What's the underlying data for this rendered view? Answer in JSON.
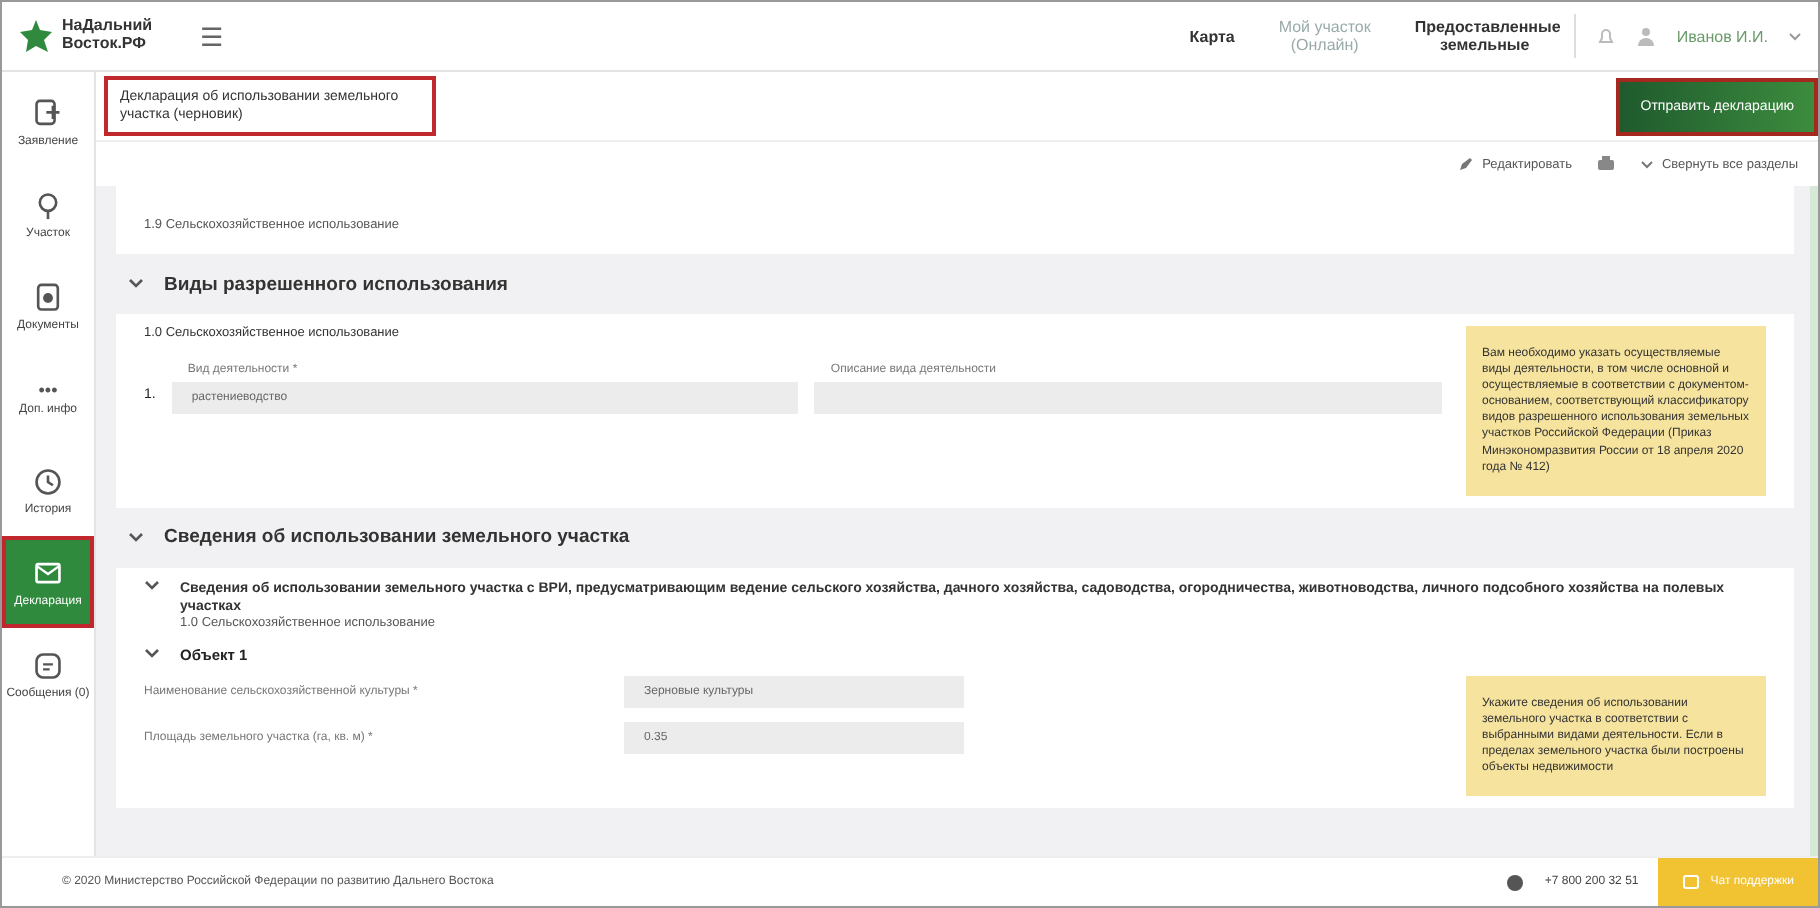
{
  "header": {
    "logo": [
      "НаДальний",
      "Восток.РФ"
    ],
    "menu_glyph": "☰",
    "nav": [
      {
        "label": "Карта",
        "disabled": false
      },
      {
        "label": "Мой участок (Онлайн)",
        "disabled": true
      },
      {
        "label": "Предоставленные земельные",
        "disabled": false
      }
    ],
    "user": "Иванов И.И."
  },
  "sidebar": {
    "items": [
      {
        "label": "Заявление",
        "selected": false,
        "highlighted": false
      },
      {
        "label": "Участок",
        "selected": false,
        "highlighted": false
      },
      {
        "label": "Документы",
        "selected": false,
        "highlighted": false
      },
      {
        "label": "Доп. инфо",
        "glyph": "•••",
        "selected": false,
        "highlighted": false
      },
      {
        "label": "История",
        "selected": false,
        "highlighted": false
      },
      {
        "label": "Декларация",
        "selected": true,
        "highlighted": true
      },
      {
        "label": "Сообщения (0)",
        "selected": false,
        "highlighted": false
      }
    ]
  },
  "document": {
    "title": "Декларация об использовании земельного участка (черновик)",
    "highlighted": true,
    "send_button": {
      "label": "Отправить декларацию",
      "highlighted": true
    },
    "toolbar": [
      "Редактировать",
      "Свернуть все разделы"
    ]
  },
  "top_card": {
    "text": "1.9 Сельскохозяйственное использование"
  },
  "sections": [
    {
      "title": "Виды разрешенного использования",
      "expanded": true,
      "kind": "activities",
      "subtitle": "1.0 Сельскохозяйственное использование",
      "row_number": "1.",
      "fields": [
        {
          "label": "Вид деятельности *",
          "value": "растениеводство"
        },
        {
          "label": "Описание вида деятельности"
        }
      ],
      "note": "Вам необходимо указать осуществляемые виды деятельности, в том числе основной и осуществляемые в соответствии с документом-основанием, соответствующий классификатору видов разрешенного использования земельных участков Российской Федерации (Приказ Минэкономразвития России от 18 апреля 2020 года № 412)"
    },
    {
      "title": "Сведения об использовании земельного участка",
      "expanded": true,
      "kind": "usage",
      "subsection": {
        "title": "Сведения об использовании земельного участка с ВРИ, предусматривающим ведение сельского хозяйства, дачного хозяйства, садоводства, огородничества, животноводства, личного подсобного хозяйства на полевых участках",
        "caption": "1.0 Сельскохозяйственное использование",
        "expanded": true
      },
      "object": {
        "title": "Объект 1",
        "expanded": true
      },
      "fields": [
        {
          "label": "Наименование сельскохозяйственной культуры *",
          "value": "Зерновые культуры"
        },
        {
          "label": "Площадь земельного участка (га, кв. м) *",
          "value": "0.35"
        }
      ],
      "note": "Укажите сведения об использовании земельного участка в соответствии с выбранными видами деятельности. Если в пределах земельного участка были построены объекты недвижимости"
    }
  ],
  "footer": {
    "copyright": "© 2020 Министерство Российской Федерации по развитию Дальнего Востока",
    "phone": "+7 800 200 32 51",
    "chat_button": "Чат поддержки"
  }
}
